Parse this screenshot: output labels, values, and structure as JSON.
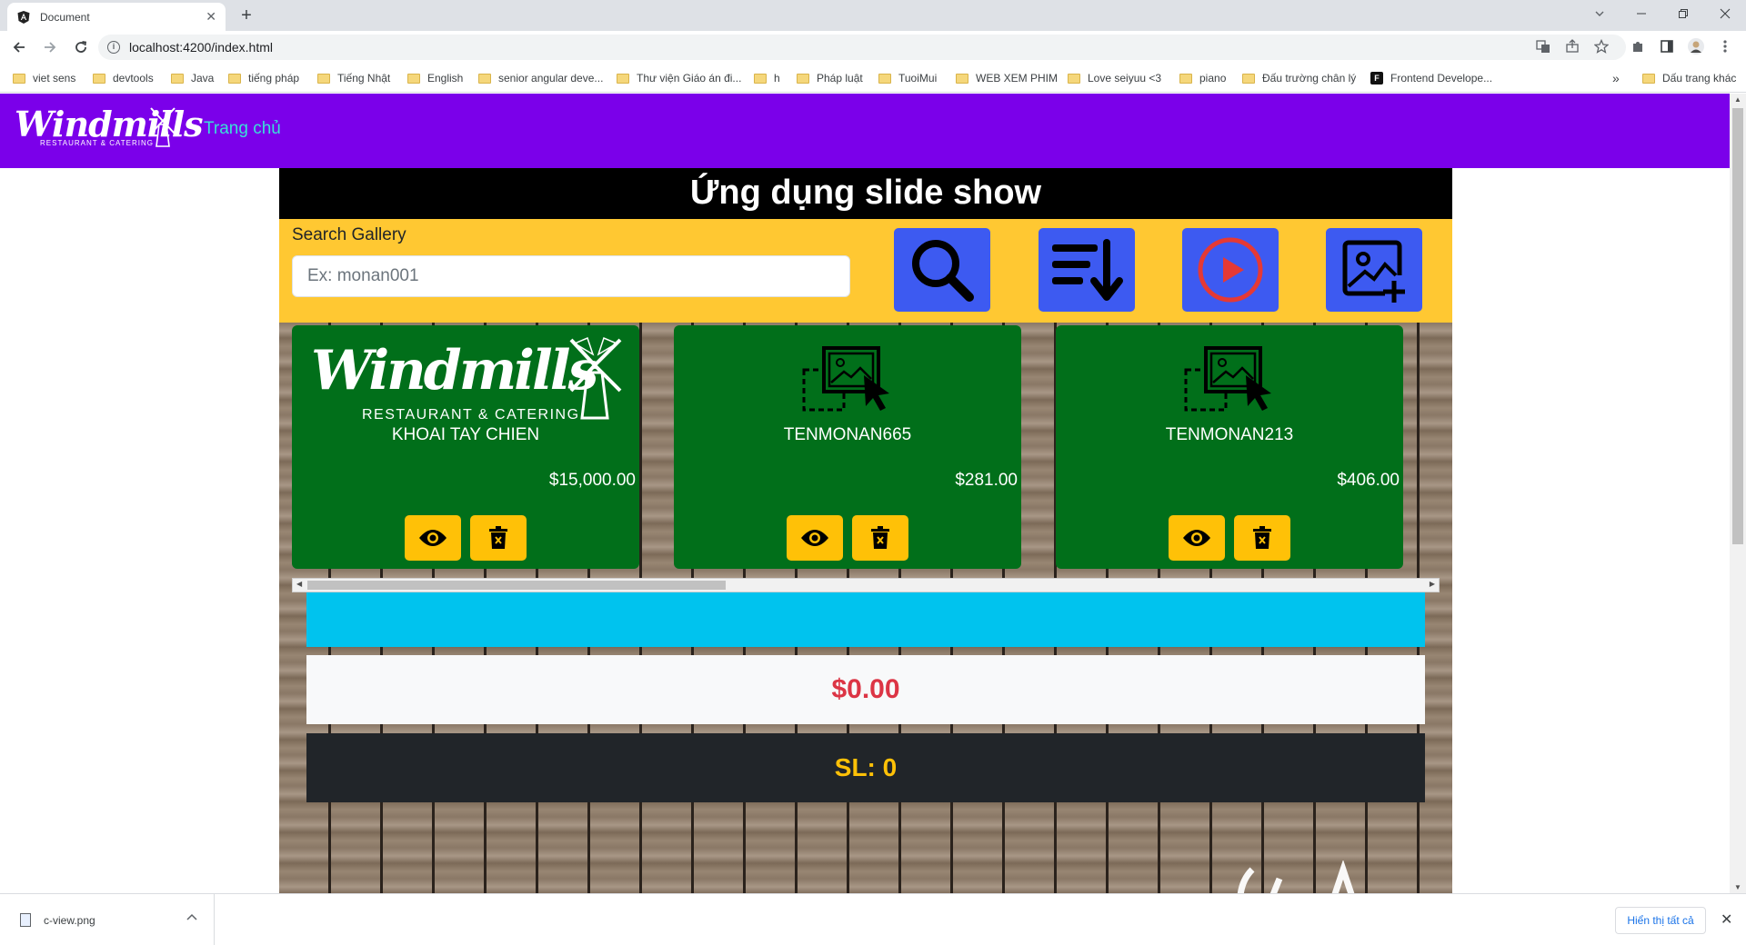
{
  "browser": {
    "tab_title": "Document",
    "tab_close": "✕",
    "new_tab": "+",
    "url": "localhost:4200/index.html",
    "bookmarks": [
      "viet sens",
      "devtools",
      "Java",
      "tiếng pháp",
      "Tiếng Nhật",
      "English",
      "senior angular deve...",
      "Thư viện Giáo án đi...",
      "h",
      "Pháp luật",
      "TuoiMui",
      "WEB XEM PHIM",
      "Love seiyuu <3",
      "piano",
      "Đấu trường chân lý",
      "Frontend Develope..."
    ],
    "bookmarks_more": "»",
    "other_bookmarks": "Dấu trang khác"
  },
  "navbar": {
    "brand": "Windmills",
    "brand_sub": "RESTAURANT & CATERING",
    "home_link": "Trang chủ"
  },
  "page": {
    "title": "Ứng dụng slide show",
    "search_label": "Search Gallery",
    "search_placeholder": "Ex: monan001",
    "search_value": ""
  },
  "tools": [
    {
      "icon": "search-icon"
    },
    {
      "icon": "sort-icon"
    },
    {
      "icon": "play-icon"
    },
    {
      "icon": "add-image-icon"
    }
  ],
  "cards": [
    {
      "image": "windmills-logo",
      "name": "KHOAI TAY CHIEN",
      "price": "$15,000.00"
    },
    {
      "image": "placeholder-image-icon",
      "name": "TENMONAN665",
      "price": "$281.00"
    },
    {
      "image": "placeholder-image-icon",
      "name": "TENMONAN213",
      "price": "$406.00"
    }
  ],
  "summary": {
    "total": "$0.00",
    "quantity": "SL: 0"
  },
  "downloads": {
    "file": "c-view.png",
    "show_all": "Hiển thị tất cả",
    "close": "✕"
  },
  "colors": {
    "navbar": "#7b00ea",
    "nav_link": "#3ae0d8",
    "toolbar": "#ffc832",
    "tool_button": "#3d5af1",
    "card": "#016f1a",
    "action_button": "#ffc107",
    "cyan_bar": "#00c3ee",
    "total_text": "#dc3545",
    "qty_bg": "#212529",
    "qty_text": "#ffc107"
  }
}
